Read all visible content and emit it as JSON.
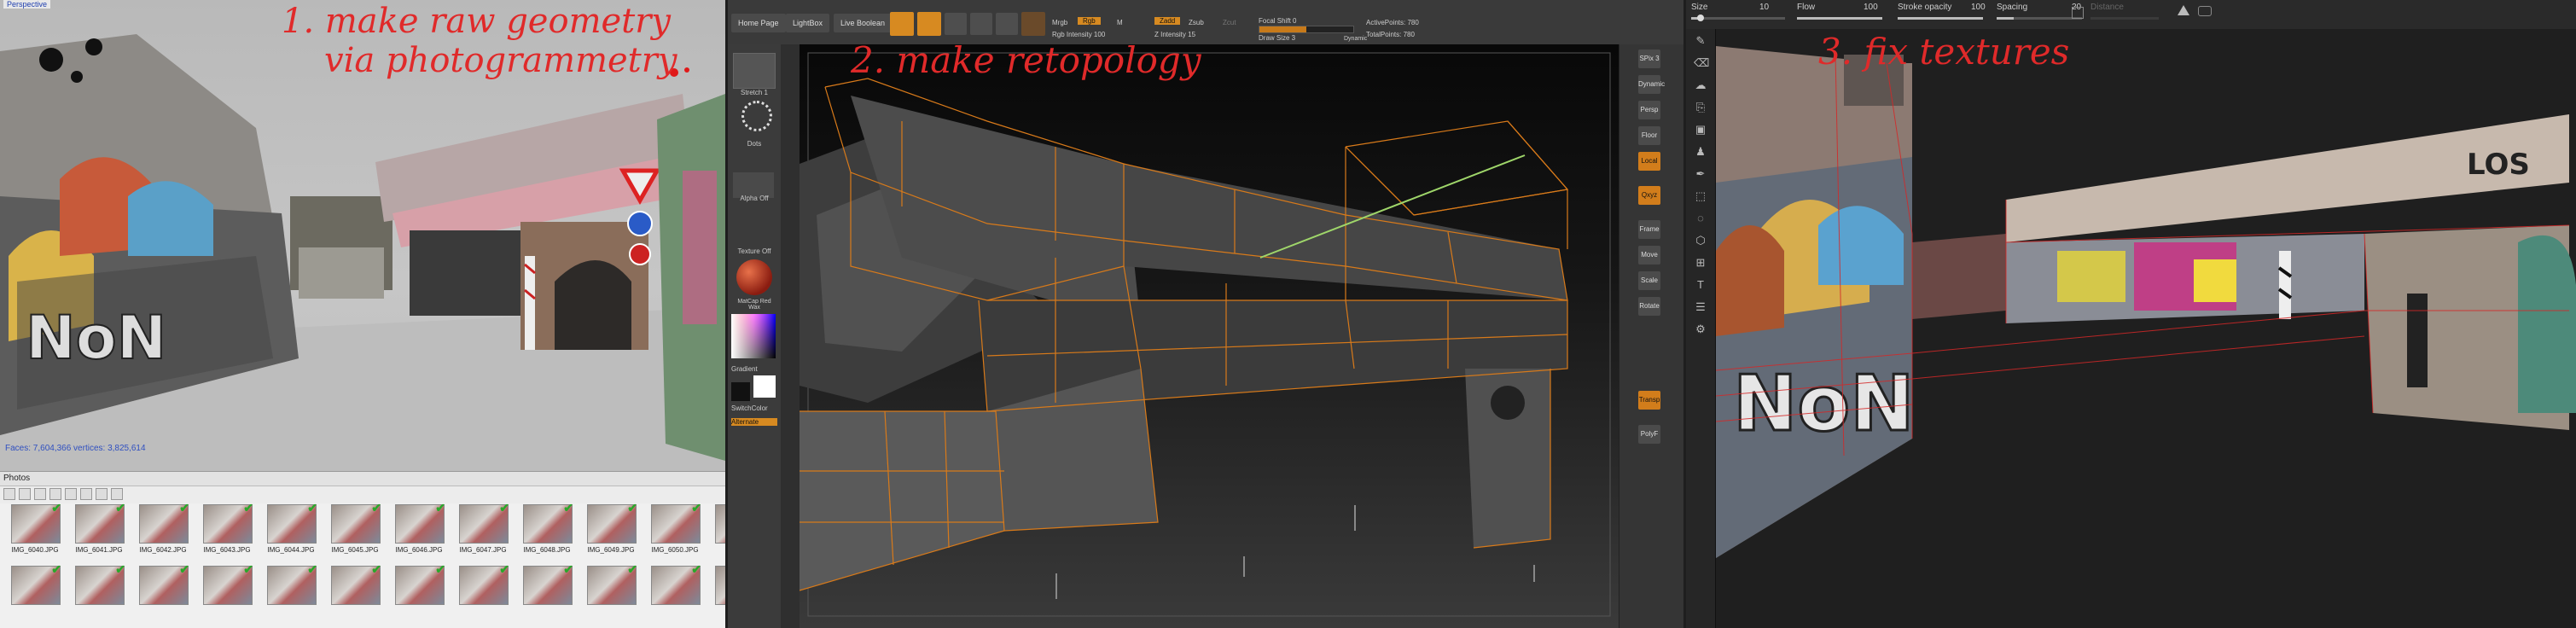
{
  "panel1": {
    "viewport_title": "Perspective",
    "annotation_line1": "1. make raw geometry",
    "annotation_line2": "via photogrammetry",
    "stats": "Faces: 7,604,366  vertices: 3,825,614",
    "photos_title": "Photos",
    "thumbnails": [
      {
        "name": "IMG_6040.JPG"
      },
      {
        "name": "IMG_6041.JPG"
      },
      {
        "name": "IMG_6042.JPG"
      },
      {
        "name": "IMG_6043.JPG"
      },
      {
        "name": "IMG_6044.JPG"
      },
      {
        "name": "IMG_6045.JPG"
      },
      {
        "name": "IMG_6046.JPG"
      },
      {
        "name": "IMG_6047.JPG"
      },
      {
        "name": "IMG_6048.JPG"
      },
      {
        "name": "IMG_6049.JPG"
      },
      {
        "name": "IMG_6050.JPG"
      },
      {
        "name": "IMG_"
      },
      {
        "name": ""
      },
      {
        "name": ""
      },
      {
        "name": ""
      },
      {
        "name": ""
      },
      {
        "name": ""
      },
      {
        "name": ""
      },
      {
        "name": ""
      },
      {
        "name": ""
      },
      {
        "name": ""
      },
      {
        "name": ""
      },
      {
        "name": ""
      },
      {
        "name": ""
      }
    ],
    "check_glyph": "✔"
  },
  "panel2": {
    "annotation": "2. make retopology",
    "buttons": {
      "home": "Home Page",
      "lightbox": "LightBox",
      "live_boolean": "Live Boolean"
    },
    "toolbar": {
      "mrgb": "Mrgb",
      "rgb": "Rgb",
      "m": "M",
      "rgb_intensity": "Rgb Intensity 100",
      "zadd": "Zadd",
      "zsub": "Zsub",
      "zcut": "Zcut",
      "z_intensity": "Z Intensity 15",
      "focal_shift": "Focal Shift 0",
      "draw_size": "Draw Size 3",
      "dynamic": "Dynamic",
      "active_points": "ActivePoints: 780",
      "total_points": "TotalPoints: 780"
    },
    "toolbar_icons": [
      "Edit",
      "Draw",
      "Move",
      "Scale",
      "Rotate"
    ],
    "lefttray": {
      "stroke": "Stretch 1",
      "dots": "Dots",
      "alpha": "Alpha Off",
      "texture": "Texture Off",
      "material": "MatCap Red Wax",
      "gradient": "Gradient",
      "switch": "SwitchColor",
      "alternate": "Alternate"
    },
    "righttray": [
      "SPix 3",
      "Dynamic",
      "Persp",
      "Floor",
      "Local",
      "Qxyz",
      "Frame",
      "Move",
      "Scale",
      "Rotate",
      "Transp",
      "PolyF"
    ]
  },
  "panel3": {
    "annotation": "3. fix textures",
    "sliders": {
      "size_label": "Size",
      "size_value": "10",
      "size_fraction": 0.1,
      "flow_label": "Flow",
      "flow_value": "100",
      "flow_fraction": 1.0,
      "stroke_opacity_label": "Stroke opacity",
      "stroke_opacity_value": "100",
      "stroke_opacity_fraction": 1.0,
      "spacing_label": "Spacing",
      "spacing_value": "20",
      "spacing_fraction": 0.2,
      "distance_label": "Distance"
    },
    "tools": [
      "brush-icon",
      "eraser-icon",
      "smudge-icon",
      "clone-icon",
      "fill-icon",
      "stamp-icon",
      "picker-icon",
      "selection-icon",
      "lasso-icon",
      "polygon-icon",
      "ruler-icon",
      "text-icon",
      "layers-icon",
      "settings-icon"
    ]
  },
  "colors": {
    "accent_orange": "#d78a21",
    "annotation_red": "#e02a2a",
    "check_green": "#2aa82a"
  }
}
